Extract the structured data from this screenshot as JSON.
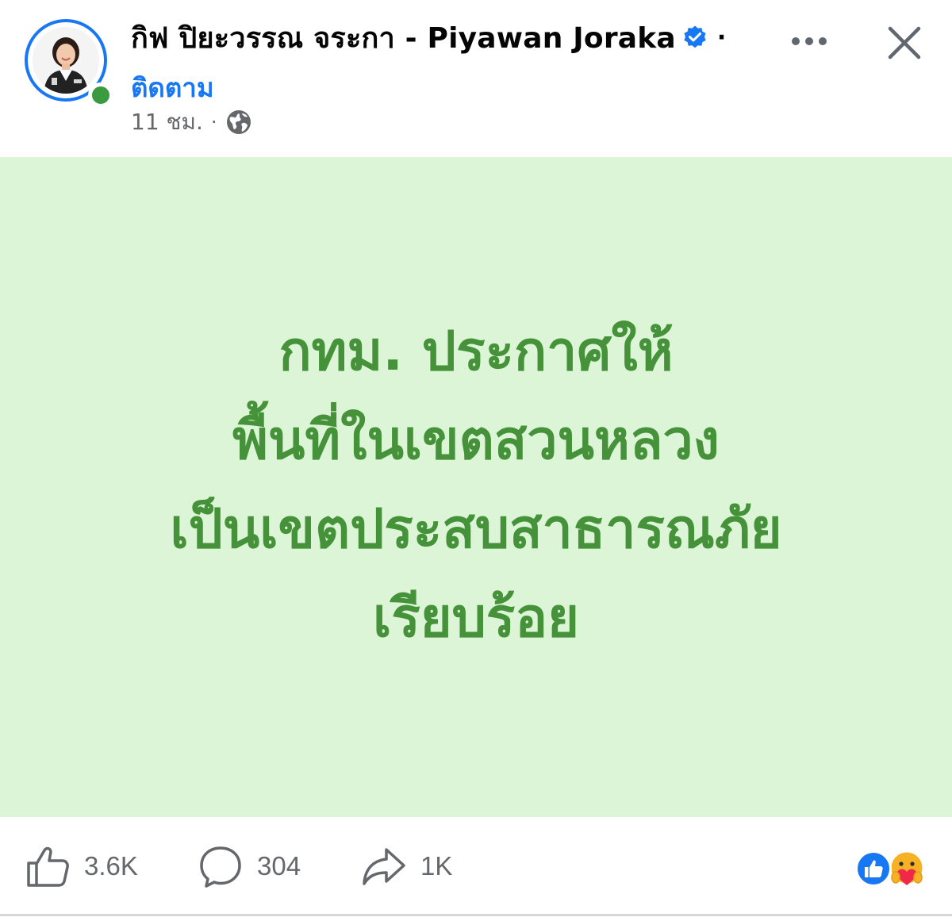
{
  "header": {
    "page_name": "กิฟ ปิยะวรรณ จระกา - Piyawan Joraka",
    "name_separator": "·",
    "follow_label": "ติดตาม",
    "timestamp": "11 ชม.",
    "meta_separator": "·",
    "verified": true,
    "online": true
  },
  "post": {
    "background_color": "#dcf5d6",
    "text_color": "#45923b",
    "lines": [
      "กทม. ประกาศให้",
      "พื้นที่ในเขตสวนหลวง",
      "เป็นเขตประสบสาธารณภัย",
      "เรียบร้อย"
    ]
  },
  "footer": {
    "like_count": "3.6K",
    "comment_count": "304",
    "share_count": "1K",
    "reactions": [
      "like",
      "care"
    ]
  },
  "colors": {
    "accent": "#1877f2",
    "online": "#3a9a3f",
    "muted": "#65676b"
  },
  "icons": {
    "more": "more-horizontal-icon",
    "close": "close-icon",
    "verified": "verified-badge-icon",
    "privacy": "globe-icon",
    "like": "thumbs-up-icon",
    "comment": "comment-bubble-icon",
    "share": "share-arrow-icon"
  }
}
